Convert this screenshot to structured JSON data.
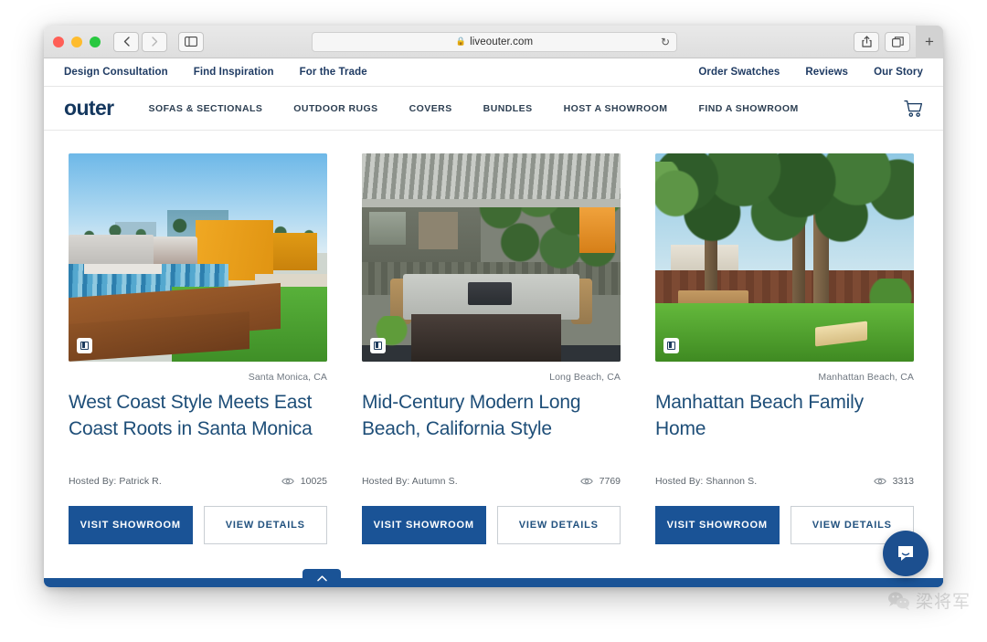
{
  "browser": {
    "url": "liveouter.com",
    "lock_icon": "lock-icon",
    "back_icon": "chevron-left-icon",
    "forward_icon": "chevron-right-icon",
    "sidebar_icon": "sidebar-icon",
    "reload_icon": "reload-icon",
    "share_icon": "share-icon",
    "tabs_icon": "tabs-overview-icon",
    "new_tab_icon": "plus-icon"
  },
  "utility_bar": {
    "left_links": [
      {
        "label": "Design Consultation"
      },
      {
        "label": "Find Inspiration"
      },
      {
        "label": "For the Trade"
      }
    ],
    "right_links": [
      {
        "label": "Order Swatches"
      },
      {
        "label": "Reviews"
      },
      {
        "label": "Our Story"
      }
    ]
  },
  "main_nav": {
    "brand": "outer",
    "links": [
      {
        "label": "SOFAS & SECTIONALS"
      },
      {
        "label": "OUTDOOR RUGS"
      },
      {
        "label": "COVERS"
      },
      {
        "label": "BUNDLES"
      },
      {
        "label": "HOST A SHOWROOM"
      },
      {
        "label": "FIND A SHOWROOM"
      }
    ],
    "cart_icon": "shopping-cart-icon"
  },
  "cards": [
    {
      "location": "Santa Monica, CA",
      "title": "West Coast Style Meets East Coast Roots in Santa Monica",
      "host": "Hosted By: Patrick R.",
      "views": "10025",
      "primary_button": "VISIT SHOWROOM",
      "secondary_button": "VIEW DETAILS",
      "badge_icon": "photo-gallery-icon",
      "views_icon": "eye-icon"
    },
    {
      "location": "Long Beach, CA",
      "title": "Mid-Century Modern Long Beach, California Style",
      "host": "Hosted By: Autumn S.",
      "views": "7769",
      "primary_button": "VISIT SHOWROOM",
      "secondary_button": "VIEW DETAILS",
      "badge_icon": "photo-gallery-icon",
      "views_icon": "eye-icon"
    },
    {
      "location": "Manhattan Beach, CA",
      "title": "Manhattan Beach Family Home",
      "host": "Hosted By: Shannon S.",
      "views": "3313",
      "primary_button": "VISIT SHOWROOM",
      "secondary_button": "VIEW DETAILS",
      "badge_icon": "photo-gallery-icon",
      "views_icon": "eye-icon"
    }
  ],
  "footer": {
    "scroll_top_icon": "chevron-up-icon",
    "chat_icon": "chat-bubble-icon"
  },
  "watermark": {
    "logo_icon": "wechat-icon",
    "text": "梁将军"
  },
  "colors": {
    "brand_navy": "#14375e",
    "primary_blue": "#1a5396",
    "title_blue": "#1e4e78",
    "muted_text": "#6f7780"
  }
}
